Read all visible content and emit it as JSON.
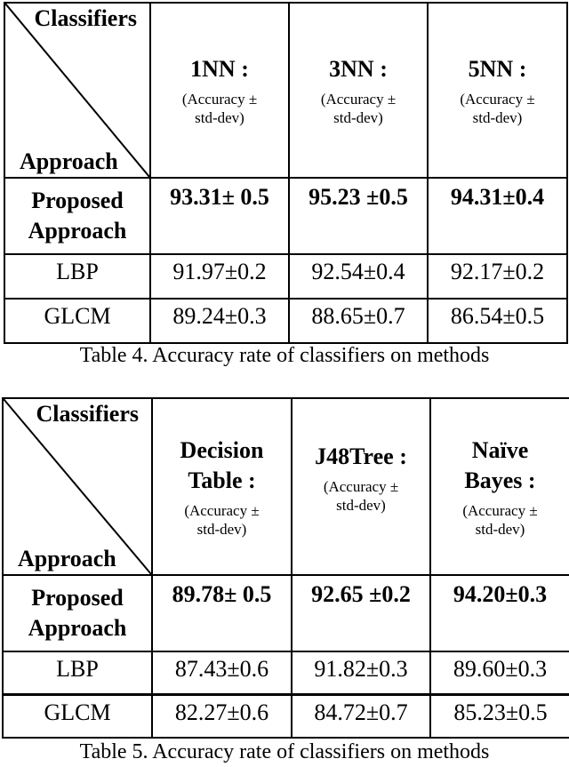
{
  "tables": [
    {
      "corner_top": "Classifiers",
      "corner_bottom": "Approach",
      "classifiers": [
        {
          "name": "1NN :",
          "sub": "(Accuracy ± std-dev)"
        },
        {
          "name": "3NN :",
          "sub": "(Accuracy ± std-dev)"
        },
        {
          "name": "5NN :",
          "sub": "(Accuracy ± std-dev)"
        }
      ],
      "rows": [
        {
          "label": "Proposed Approach",
          "values": [
            "93.31± 0.5",
            "95.23 ±0.5",
            "94.31±0.4"
          ]
        },
        {
          "label": "LBP",
          "values": [
            "91.97±0.2",
            "92.54±0.4",
            "92.17±0.2"
          ]
        },
        {
          "label": "GLCM",
          "values": [
            "89.24±0.3",
            "88.65±0.7",
            "86.54±0.5"
          ]
        }
      ],
      "caption": "Table 4. Accuracy rate of classifiers on methods"
    },
    {
      "corner_top": "Classifiers",
      "corner_bottom": "Approach",
      "classifiers": [
        {
          "name": "Decision Table :",
          "sub": "(Accuracy ± std-dev)"
        },
        {
          "name": "J48Tree :",
          "sub": "(Accuracy ± std-dev)"
        },
        {
          "name": "Naïve Bayes :",
          "sub": "(Accuracy ± std-dev)"
        }
      ],
      "rows": [
        {
          "label": "Proposed Approach",
          "values": [
            "89.78± 0.5",
            "92.65 ±0.2",
            "94.20±0.3"
          ]
        },
        {
          "label": "LBP",
          "values": [
            "87.43±0.6",
            "91.82±0.3",
            "89.60±0.3"
          ]
        },
        {
          "label": "GLCM",
          "values": [
            "82.27±0.6",
            "84.72±0.7",
            "85.23±0.5"
          ]
        }
      ],
      "caption": "Table 5. Accuracy rate of classifiers on methods"
    }
  ]
}
